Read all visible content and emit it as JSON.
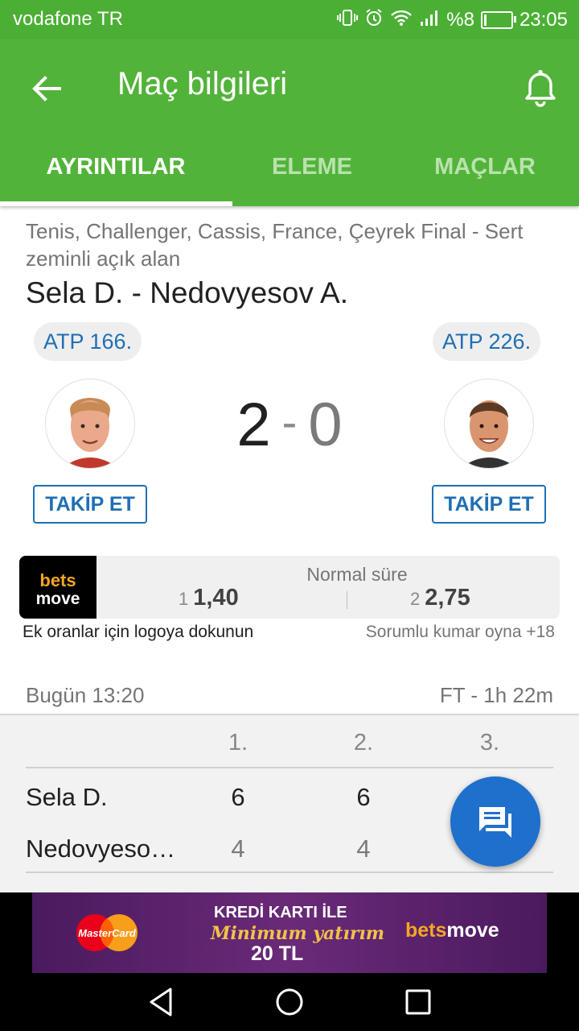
{
  "status_bar": {
    "carrier": "vodafone TR",
    "battery": "%8",
    "battery_level": 0.08,
    "time": "23:05",
    "icons": [
      "vibrate-icon",
      "alarm-icon",
      "wifi-icon",
      "signal-icon",
      "battery-charging-icon"
    ]
  },
  "appbar": {
    "title": "Maç bilgileri",
    "back_icon": "arrow-left-icon",
    "notify_icon": "bell-icon",
    "tabs": [
      {
        "label": "AYRINTILAR",
        "active": true
      },
      {
        "label": "ELEME",
        "active": false
      },
      {
        "label": "MAÇLAR",
        "active": false
      }
    ],
    "color": "#52b33a"
  },
  "match": {
    "competition": "Tenis, Challenger, Cassis, France, Çeyrek Final - Sert zeminli açık alan",
    "title": "Sela D. - Nedovyesov A.",
    "home": {
      "rank": "ATP 166.",
      "follow": "TAKİP ET",
      "avatar_icon": "player-avatar-icon"
    },
    "away": {
      "rank": "ATP 226.",
      "follow": "TAKİP ET",
      "avatar_icon": "player-avatar-icon"
    },
    "score": {
      "home": "2",
      "separator": "-",
      "away": "0"
    }
  },
  "odds": {
    "bookmaker": {
      "line1": "bets",
      "line2": "move"
    },
    "period": "Normal süre",
    "outcomes": [
      {
        "label": "1",
        "value": "1,40"
      },
      {
        "label": "2",
        "value": "2,75"
      }
    ],
    "hint": "Ek oranlar için logoya dokunun",
    "responsible": "Sorumlu kumar oyna +18"
  },
  "timing": {
    "start": "Bugün 13:20",
    "status": "FT - 1h 22m"
  },
  "sets_table": {
    "headers": [
      "1.",
      "2.",
      "3."
    ],
    "rows": [
      {
        "name": "Sela D.",
        "sets": [
          "6",
          "6"
        ]
      },
      {
        "name": "Nedovyesov A.",
        "sets": [
          "4",
          "4"
        ]
      }
    ]
  },
  "fab": {
    "icon": "chat-icon",
    "color": "#1f6fcc"
  },
  "ad": {
    "line1": "KREDİ KARTI İLE",
    "line2": "Minimum yatırım",
    "line3": "20 TL",
    "card": "MasterCard",
    "brand_a": "bets",
    "brand_b": "move"
  },
  "navbar": {
    "icons": [
      "back-triangle-icon",
      "home-circle-icon",
      "recents-square-icon"
    ]
  }
}
